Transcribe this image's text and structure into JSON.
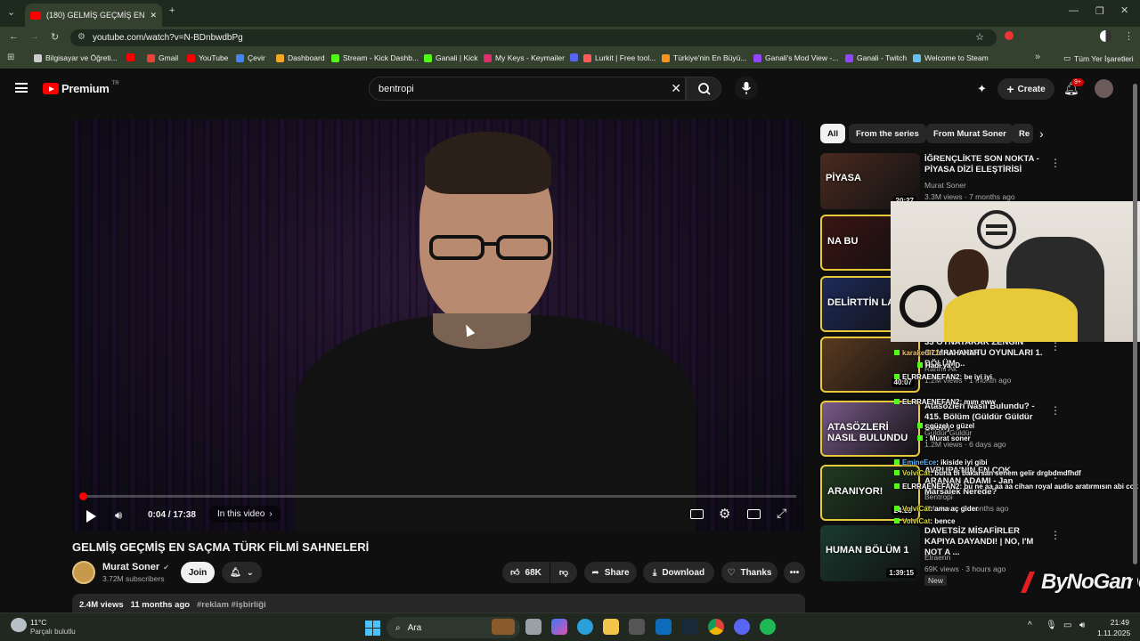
{
  "browser": {
    "tab_title": "(180) GELMİŞ GEÇMİŞ EN SAÇMA",
    "url": "youtube.com/watch?v=N-BDnbwdbPg",
    "bookmarks": [
      {
        "label": "Bilgisayar ve Öğreti...",
        "color": "#cccccc"
      },
      {
        "label": "",
        "color": "#ff0000"
      },
      {
        "label": "Gmail",
        "color": "#ea4335"
      },
      {
        "label": "YouTube",
        "color": "#ff0000"
      },
      {
        "label": "Çevir",
        "color": "#4285f4"
      },
      {
        "label": "Dashboard",
        "color": "#f5a623"
      },
      {
        "label": "Stream - Kick Dashb...",
        "color": "#53fc18"
      },
      {
        "label": "Ganali | Kick",
        "color": "#53fc18"
      },
      {
        "label": "My Keys - Keymailer",
        "color": "#e02f6b"
      },
      {
        "label": "",
        "color": "#5865f2"
      },
      {
        "label": "Lurkit | Free tool...",
        "color": "#ff5b5b"
      },
      {
        "label": "Türkiye'nin En Büyü...",
        "color": "#f7931e"
      },
      {
        "label": "Ganali's Mod View -...",
        "color": "#9146ff"
      },
      {
        "label": "Ganali - Twitch",
        "color": "#9146ff"
      },
      {
        "label": "Welcome to Steam",
        "color": "#66c0f4"
      }
    ],
    "all_bookmarks": "Tüm Yer İşaretleri"
  },
  "youtube": {
    "logo": "Premium",
    "logo_sup": "TR",
    "search_value": "bentropi",
    "create_label": "Create",
    "notif_count": "9+"
  },
  "player": {
    "time": "0:04 / 17:38",
    "in_this_video": "In this video",
    "progress": 0.004
  },
  "video": {
    "title": "GELMİŞ GEÇMİŞ EN SAÇMA TÜRK FİLMİ SAHNELERİ",
    "channel": "Murat Soner",
    "subscribers": "3.72M subscribers",
    "join": "Join",
    "likes": "68K",
    "share": "Share",
    "download": "Download",
    "thanks": "Thanks",
    "views": "2.4M views",
    "age": "11 months ago",
    "tags": "#reklam #işbirliği"
  },
  "chips": [
    "All",
    "From the series",
    "From Murat Soner",
    "Re"
  ],
  "recommendations": [
    {
      "title": "İĞRENÇLİKTE SON NOKTA - PİYASA DİZİ ELEŞTİRİSİ",
      "channel": "Murat Soner",
      "meta": "3.3M views · 7 months ago",
      "duration": "20:27",
      "thumb": "#4a2a20",
      "thumb_text": "PİYASA"
    },
    {
      "title": "",
      "channel": "",
      "meta": "",
      "duration": "",
      "thumb": "#3a1412",
      "thumb_text": "NA BU"
    },
    {
      "title": "",
      "channel": "",
      "meta": "",
      "duration": "",
      "thumb": "#1e2a5a",
      "thumb_text": "DELİRTTİN LAN BE"
    },
    {
      "title": "33 OYNAYARAK ZENGİN OLMAK ! KUTU OYUNLARI 1. BÖLÜM ...",
      "channel": "Rahmi Ak",
      "meta": "1.2M views · 1 month ago",
      "duration": "40:07",
      "thumb": "#5a3a20",
      "thumb_text": ""
    },
    {
      "title": "Atasözleri Nasıl Bulundu? - 415. Bölüm (Güldür Güldür Show)",
      "channel": "Güldür Güldür",
      "meta": "1.2M views · 6 days ago",
      "duration": "",
      "thumb": "#7a5a8a",
      "thumb_text": "ATASÖZLERİ NASIL BULUNDU"
    },
    {
      "title": "AVRUPA'NIN EN ÇOK ARANAN ADAMI - Jan Marsalek Nerede?",
      "channel": "Bentropi",
      "meta": "2M views · 2 months ago",
      "duration": "24:23",
      "thumb": "#203a20",
      "thumb_text": "ARANIYOR!"
    },
    {
      "title": "DAVETSİZ MİSAFİRLER KAPIYA DAYANDI! | NO, I'M NOT A ...",
      "channel": "Elraenn",
      "meta": "69K views · 3 hours ago",
      "duration": "1:39:15",
      "badge": "New",
      "thumb": "#1a3a30",
      "thumb_text": "HUMAN BÖLÜM 1"
    }
  ],
  "chat": [
    {
      "user": "karakedi71",
      "msg": ": HAHAHAH",
      "color": "#e8c27a"
    },
    {
      "user": "",
      "msg": "Hadi ya :D",
      "color": "#ffffff"
    },
    {
      "user": "ELRRAENEFAN2",
      "msg": ": be iyi iyi",
      "color": "#ffffff"
    },
    {
      "user": "ELRRAENEFAN2",
      "msg": ": mım eww",
      "color": "#ffffff"
    },
    {
      "user": "",
      "msg": ": güzel o güzel",
      "color": "#ffffff"
    },
    {
      "user": "",
      "msg": ": Murat soner",
      "color": "#ffffff"
    },
    {
      "user": "EmineEce",
      "msg": ": ikiside iyi gibi",
      "color": "#5fb4ff"
    },
    {
      "user": "VolviCat",
      "msg": ": buna bi bakarsan senem gelir drgbdmdfhdf",
      "color": "#d6d64a"
    },
    {
      "user": "ELRRAENEFAN2",
      "msg": ": bu ne aa aa aa cihan royal audio aratırmısın abi cok iyi sarkı",
      "color": "#ffffff"
    },
    {
      "user": "VolviCat",
      "msg": ": ama aç gider",
      "color": "#d6d64a"
    },
    {
      "user": "VolviCat",
      "msg": ": bence",
      "color": "#d6d64a"
    }
  ],
  "watermark": "ByNoGame",
  "taskbar": {
    "temp": "11°C",
    "weather": "Parçalı bulutlu",
    "search": "Ara",
    "time": "21:49",
    "date": "1.11.2025"
  }
}
